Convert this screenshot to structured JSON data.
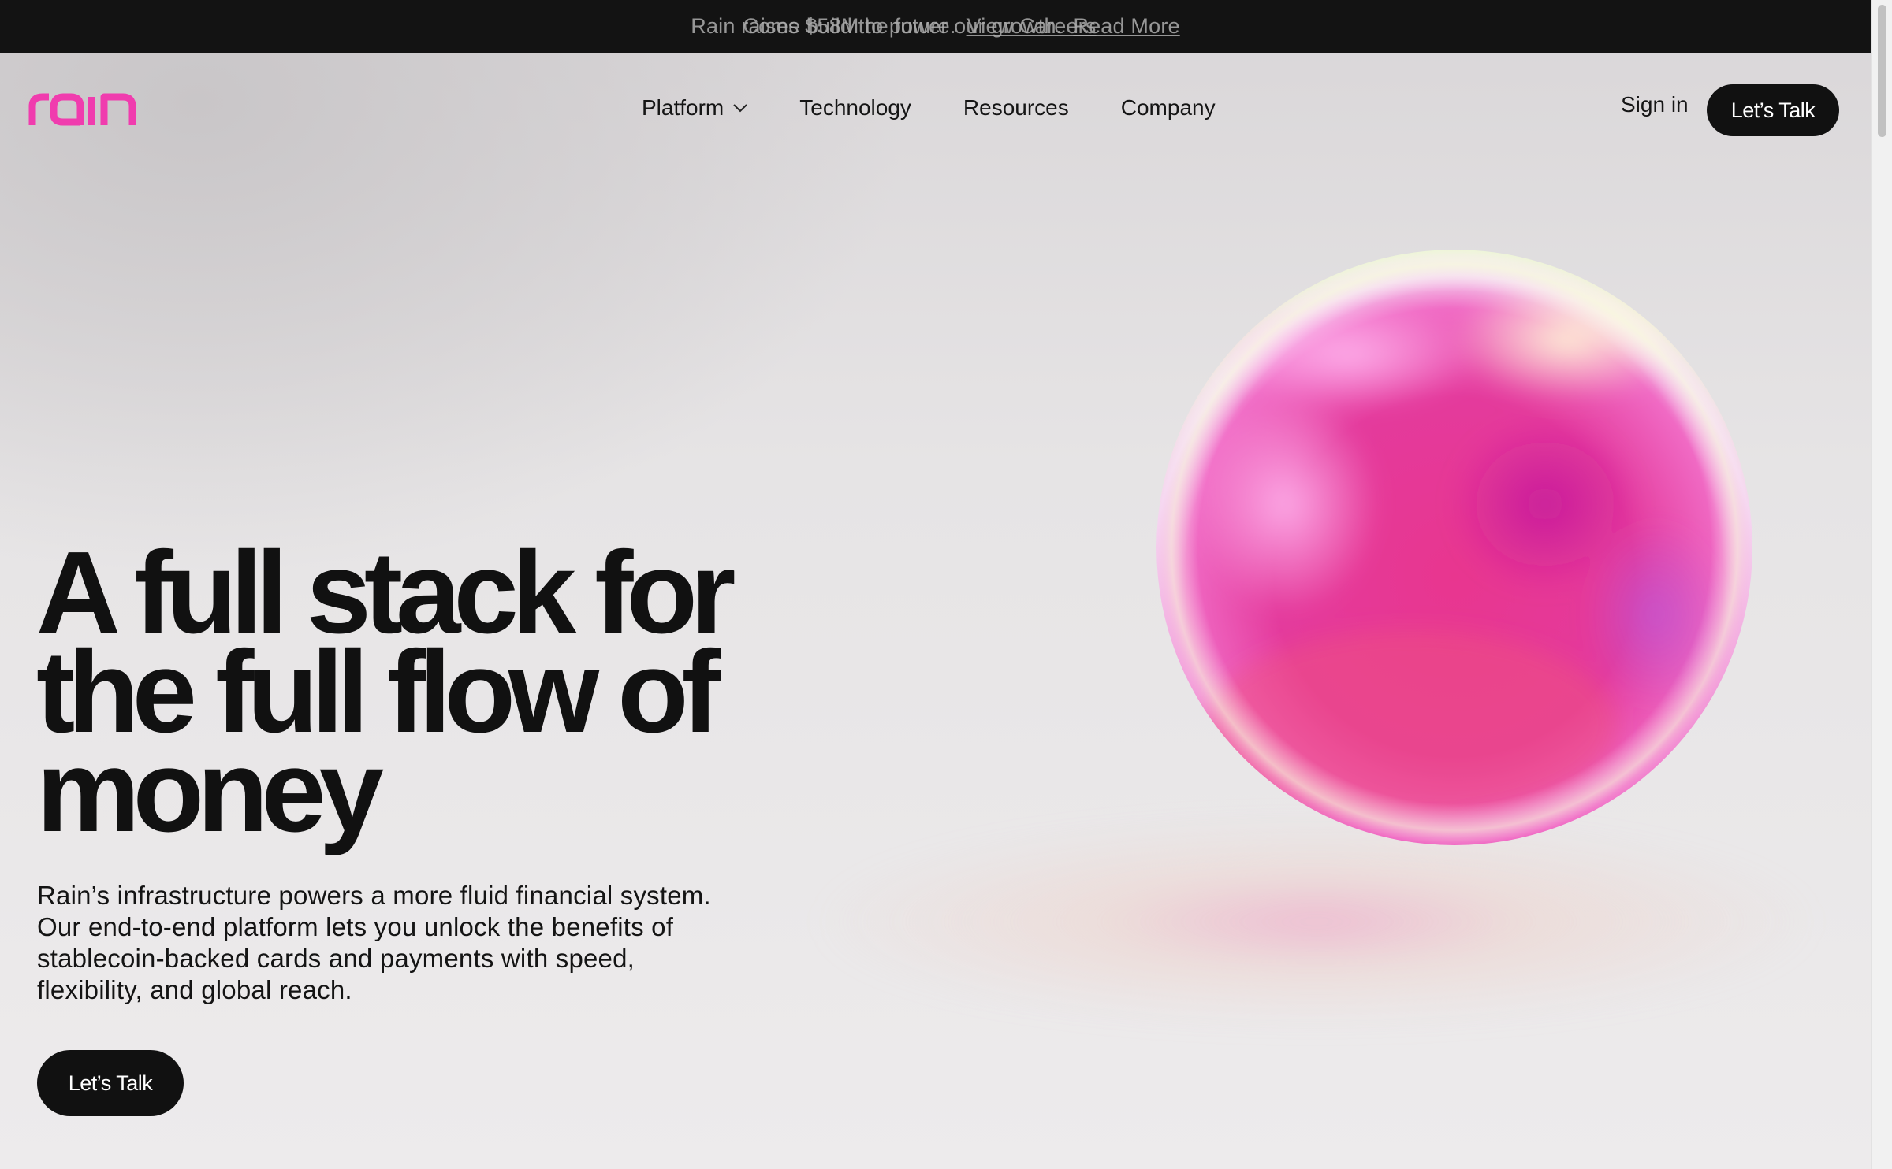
{
  "announcement": {
    "line_a_text": "Rain raises $58M to power our growth.",
    "line_a_link": "Read More",
    "line_b_text": "Come build the future.",
    "line_b_link": "View Careers"
  },
  "brand": {
    "name": "rain",
    "color": "#f03cae"
  },
  "nav": {
    "items": [
      {
        "label": "Platform",
        "has_dropdown": true
      },
      {
        "label": "Technology"
      },
      {
        "label": "Resources"
      },
      {
        "label": "Company"
      }
    ],
    "sign_in": "Sign in",
    "cta": "Let’s Talk"
  },
  "hero": {
    "title_lines": [
      "A full stack for",
      "the full flow of",
      "money"
    ],
    "body_lines": [
      "Rain’s infrastructure powers a more fluid financial system.",
      "Our end-to-end platform lets you unlock the benefits of",
      "stablecoin-backed cards and payments with speed,",
      "flexibility, and global reach."
    ],
    "cta": "Let’s Talk"
  },
  "colors": {
    "primary_dark": "#111111",
    "orb_pink": "#e8368f",
    "background": "#ebe9ea"
  }
}
